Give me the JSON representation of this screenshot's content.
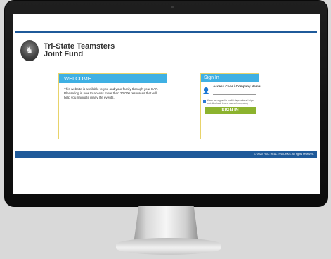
{
  "brand": {
    "line1": "Tri-State Teamsters",
    "line2": "Joint Fund"
  },
  "welcome": {
    "title": "WELCOME",
    "body": "This website is available to you and your family through your EAP. Please log in now to access more than 20,000 resources that will help you navigate many life events."
  },
  "signin": {
    "title": "Sign In",
    "field_label": "Access Code / Company Name:",
    "field_value": "",
    "remember_label": "Keep me signed in for 60 days unless I sign out (Uncheck if on a shared computer)",
    "remember_checked": true,
    "button_label": "SIGN IN"
  },
  "footer": {
    "copyright": "© 2020 HMC HEALTHWORKS. All rights reserved."
  },
  "colors": {
    "primary_blue": "#1f5a9a",
    "header_cyan": "#3fb0e3",
    "button_green": "#8cb32e",
    "box_border": "#e8d36a"
  }
}
